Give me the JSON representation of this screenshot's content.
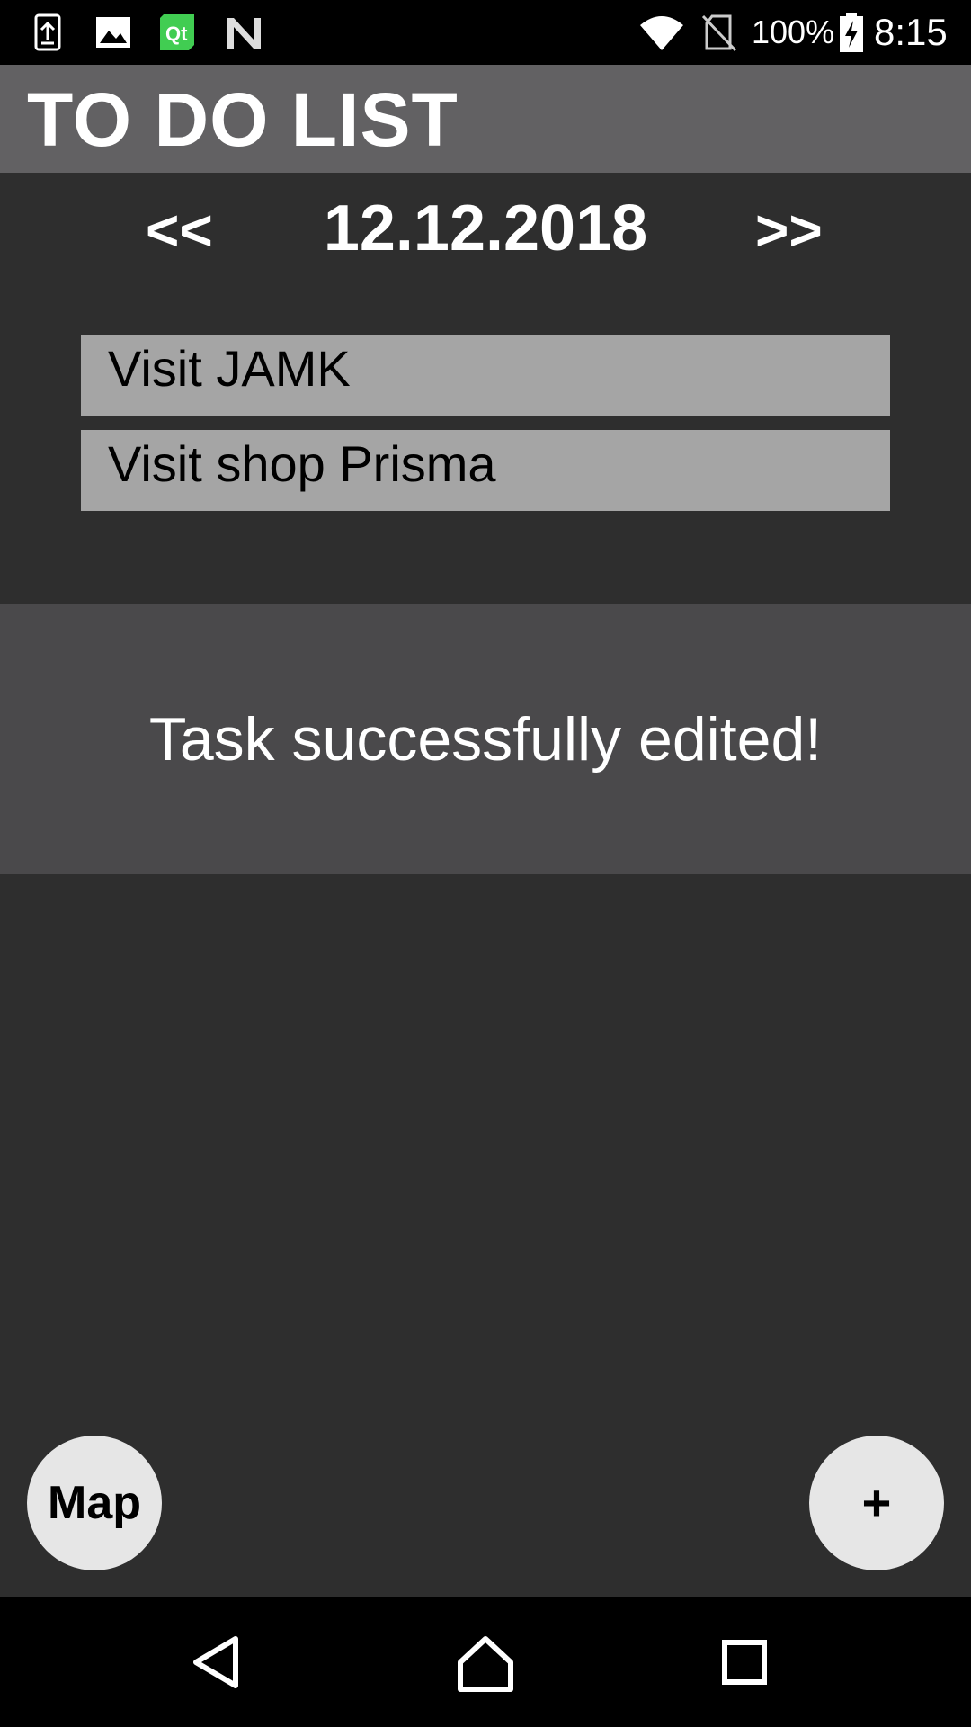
{
  "status_bar": {
    "battery_percent": "100%",
    "time": "8:15",
    "icons": [
      "upload-icon",
      "image-icon",
      "qt-icon",
      "n-icon",
      "wifi-icon",
      "no-sim-icon",
      "battery-charging-icon"
    ]
  },
  "app_bar": {
    "title": "TO DO LIST"
  },
  "date_nav": {
    "prev_label": "<<",
    "date": "12.12.2018",
    "next_label": ">>"
  },
  "tasks": [
    {
      "label": "Visit JAMK"
    },
    {
      "label": "Visit shop Prisma"
    }
  ],
  "toast": {
    "message": "Task successfully edited!"
  },
  "fabs": {
    "map_label": "Map",
    "add_label": "+"
  },
  "nav_bar": {
    "icons": [
      "back-icon",
      "home-icon",
      "recents-icon"
    ]
  },
  "colors": {
    "status_bar": "#000000",
    "app_bar": "#626163",
    "background": "#2e2e2e",
    "task_item": "#a5a5a5",
    "toast": "#4a494b",
    "fab": "#e6e6e6",
    "qt_green": "#41cd52"
  }
}
